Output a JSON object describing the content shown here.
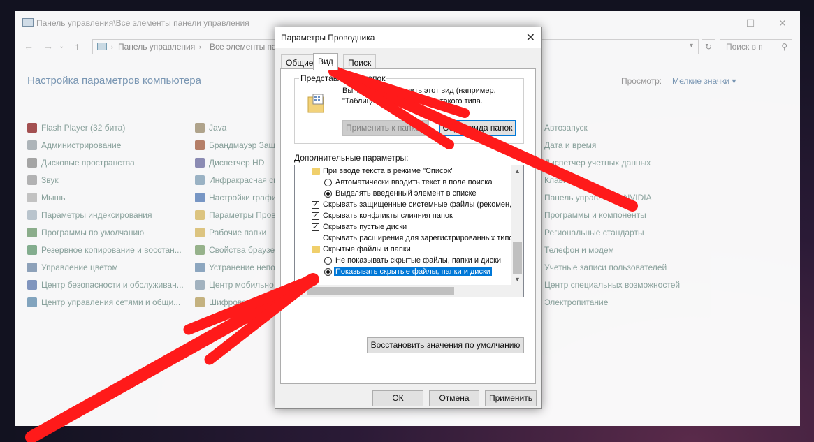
{
  "control_panel": {
    "title": "Панель управления\\Все элементы панели управления",
    "breadcrumbs": [
      "Панель управления",
      "Все элементы па"
    ],
    "search_placeholder": "Поиск в п",
    "heading": "Настройка параметров компьютера",
    "view_label": "Просмотр:",
    "view_value": "Мелкие значки ▾",
    "columns": [
      [
        "Flash Player (32 бита)",
        "Администрирование",
        "Дисковые пространства",
        "Звук",
        "Мышь",
        "Параметры индексирования",
        "Программы по умолчанию",
        "Резервное копирование и восстан...",
        "Управление цветом",
        "Центр безопасности и обслуживан...",
        "Центр управления сетями и общи..."
      ],
      [
        "Java",
        "Брандмауэр Защ",
        "Диспетчер HD",
        "Инфракрасная св",
        "Настройки графи",
        "Параметры Пров",
        "Рабочие папки",
        "Свойства браузе",
        "Устранение непо",
        "Центр мобильно",
        "Шифрование"
      ],
      [
        "Автозапуск",
        "Дата и время",
        "Диспетчер учетных данных",
        "Клавиату",
        "Панель управления NVIDIA",
        "Программы и компоненты",
        "Региональные стандарты",
        "Телефон и модем",
        "Учетные записи пользователей",
        "Центр специальных возможностей",
        "Электропитание"
      ]
    ]
  },
  "dialog": {
    "title": "Параметры Проводника",
    "close_symbol": "✕",
    "tabs": [
      "Общие",
      "Вид",
      "Поиск"
    ],
    "folder_views": {
      "legend": "Представление папок",
      "text": "Вы можете применить этот вид (например, \"Таблица\") ко всем папкам такого типа.",
      "apply_button": "Применить к папкам",
      "reset_button": "Сброс вида папок"
    },
    "advanced_label": "Дополнительные параметры:",
    "tree": [
      {
        "kind": "folder",
        "label": "При вводе текста в режиме \"Список\""
      },
      {
        "kind": "radio",
        "checked": false,
        "label": "Автоматически вводить текст в поле поиска"
      },
      {
        "kind": "radio",
        "checked": true,
        "label": "Выделять введенный элемент в списке"
      },
      {
        "kind": "check",
        "checked": true,
        "label": "Скрывать защищенные системные файлы (рекомен,"
      },
      {
        "kind": "check",
        "checked": true,
        "label": "Скрывать конфликты слияния папок"
      },
      {
        "kind": "check",
        "checked": true,
        "label": "Скрывать пустые диски"
      },
      {
        "kind": "check",
        "checked": false,
        "label": "Скрывать расширения для зарегистрированных типо"
      },
      {
        "kind": "folder",
        "label": "Скрытые файлы и папки"
      },
      {
        "kind": "radio",
        "checked": false,
        "label": "Не показывать скрытые файлы, папки и диски"
      },
      {
        "kind": "radio",
        "checked": true,
        "selected": true,
        "label": "Показывать скрытые файлы, папки и диски"
      }
    ],
    "restore_button": "Восстановить значения по умолчанию",
    "ok_button": "ОК",
    "cancel_button": "Отмена",
    "apply_button": "Применить"
  },
  "colors": {
    "accent": "#0078d7",
    "annotation_arrow": "#ff1a1a"
  }
}
